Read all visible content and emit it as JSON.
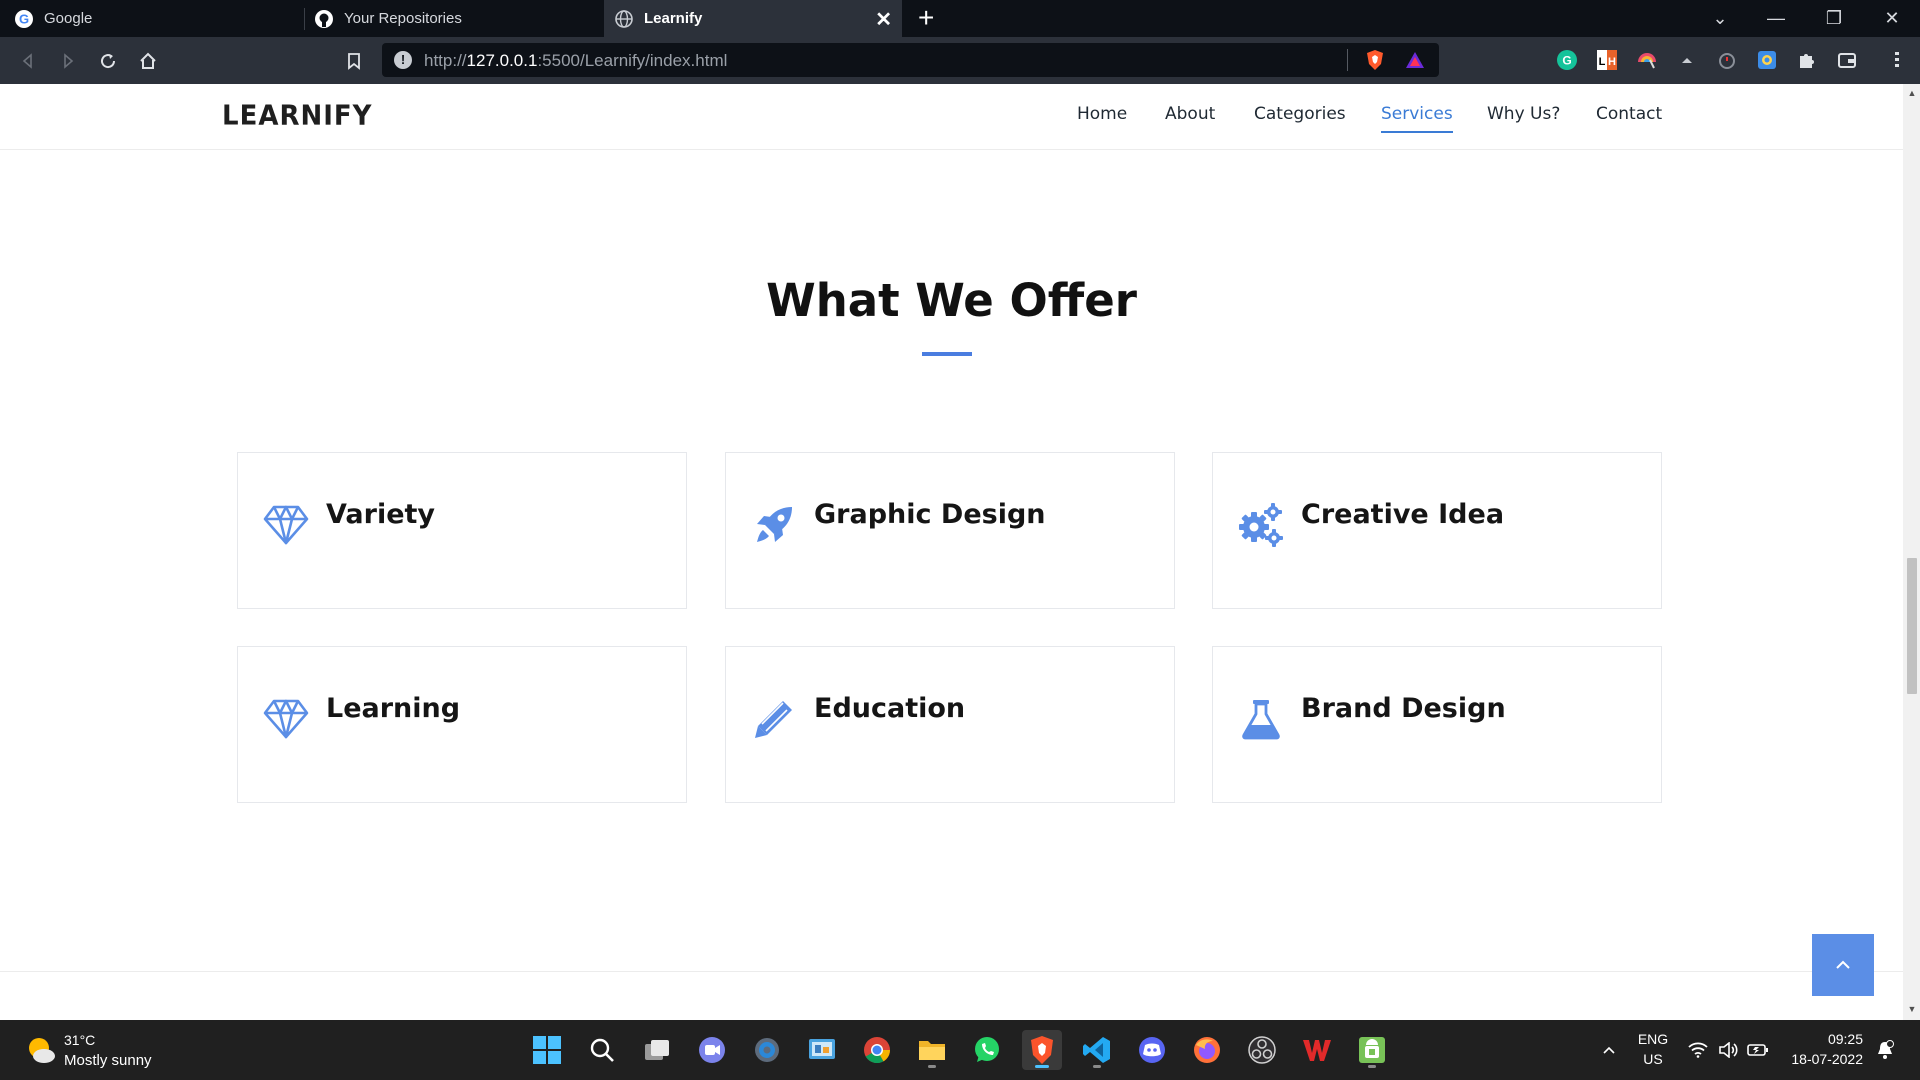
{
  "browser": {
    "tabs": [
      {
        "label": "Google",
        "icon": "google-icon"
      },
      {
        "label": "Your Repositories",
        "icon": "github-icon"
      },
      {
        "label": "Learnify",
        "icon": "globe-icon",
        "active": true
      }
    ],
    "url": {
      "prefix": "http://",
      "host": "127.0.0.1",
      "rest": ":5500/Learnify/index.html"
    }
  },
  "site": {
    "logo": "LEARNIFY",
    "nav": [
      "Home",
      "About",
      "Categories",
      "Services",
      "Why Us?",
      "Contact"
    ],
    "active_nav": "Services",
    "section_title": "What We Offer",
    "accent_color": "#4a7de0",
    "cards": [
      {
        "title": "Variety",
        "icon": "diamond-icon"
      },
      {
        "title": "Graphic Design",
        "icon": "rocket-icon"
      },
      {
        "title": "Creative Idea",
        "icon": "gears-icon"
      },
      {
        "title": "Learning",
        "icon": "diamond-icon"
      },
      {
        "title": "Education",
        "icon": "pencil-icon"
      },
      {
        "title": "Brand Design",
        "icon": "flask-icon"
      }
    ],
    "back_to_top": "^"
  },
  "taskbar": {
    "weather": {
      "temp": "31°C",
      "desc": "Mostly sunny"
    },
    "language": {
      "lang": "ENG",
      "region": "US"
    },
    "clock": {
      "time": "09:25",
      "date": "18-07-2022"
    }
  }
}
